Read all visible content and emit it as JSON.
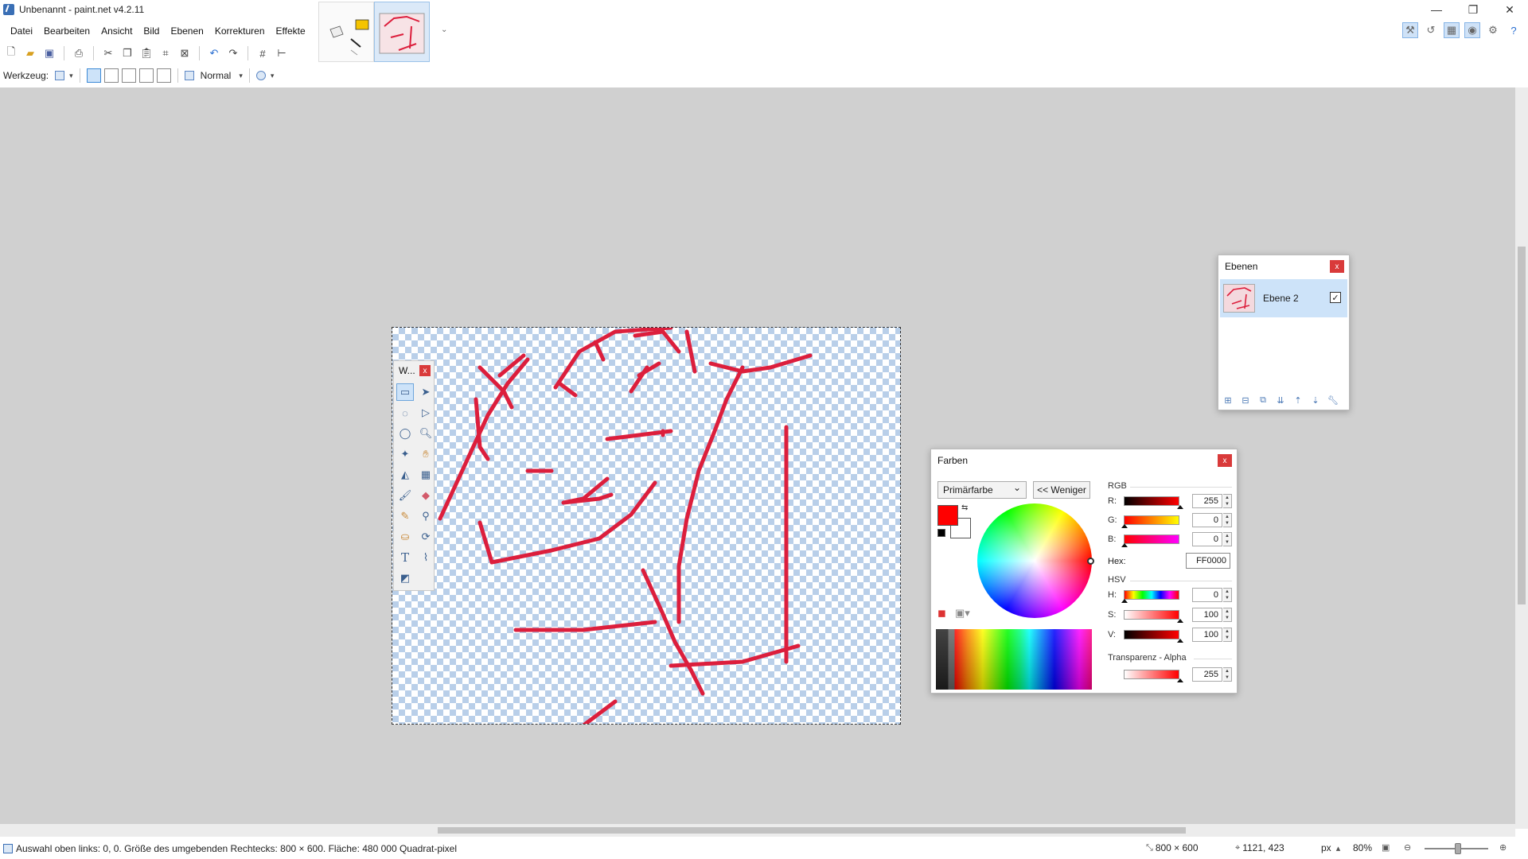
{
  "window": {
    "title": "Unbenannt - paint.net v4.2.11",
    "minimize": "—",
    "restore": "❐",
    "close": "✕"
  },
  "menu": {
    "items": [
      "Datei",
      "Bearbeiten",
      "Ansicht",
      "Bild",
      "Ebenen",
      "Korrekturen",
      "Effekte"
    ]
  },
  "toolbar": {
    "tool_label": "Werkzeug:",
    "blend_mode": "Normal"
  },
  "tools_window": {
    "title": "W...",
    "close": "x"
  },
  "layers_window": {
    "title": "Ebenen",
    "close": "x",
    "layer_name": "Ebene 2",
    "layer_visible": true
  },
  "colors_window": {
    "title": "Farben",
    "close": "x",
    "target": "Primärfarbe",
    "less_button": "<< Weniger",
    "primary_color": "#FF0000",
    "secondary_color": "#FFFFFF",
    "rgb_title": "RGB",
    "r_label": "R:",
    "g_label": "G:",
    "b_label": "B:",
    "r_value": "255",
    "g_value": "0",
    "b_value": "0",
    "hex_label": "Hex:",
    "hex_value": "FF0000",
    "hsv_title": "HSV",
    "h_label": "H:",
    "s_label": "S:",
    "v_label": "V:",
    "h_value": "0",
    "s_value": "100",
    "v_value": "100",
    "alpha_title": "Transparenz - Alpha",
    "alpha_value": "255"
  },
  "canvas": {
    "stroke_color": "#DC1E3C"
  },
  "status": {
    "selection_text": "Auswahl oben links: 0, 0. Größe des umgebenden Rechtecks: 800 × 600. Fläche: 480 000 Quadrat-pixel",
    "image_size": "800 × 600",
    "cursor_pos": "1121, 423",
    "unit": "px",
    "zoom": "80%"
  }
}
